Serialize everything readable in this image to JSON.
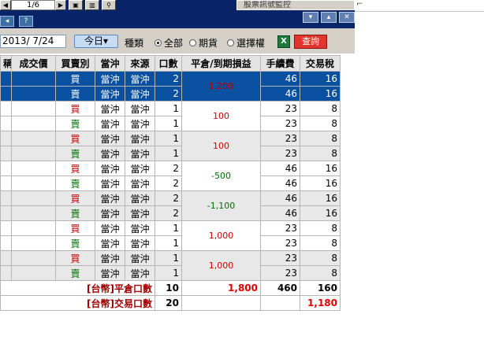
{
  "toolbar": {
    "page_info": "1/6",
    "tab_title": "股票訊號監控"
  },
  "filter": {
    "date": "2013/ 7/24",
    "today_label": "今日▾",
    "type_label": "種類",
    "radio_all": "全部",
    "radio_futures": "期貨",
    "radio_options": "選擇權",
    "query_label": "查詢",
    "excel_icon": "excel-icon"
  },
  "table": {
    "headers": [
      "稱",
      "成交價",
      "買賣別",
      "當沖",
      "來源",
      "口數",
      "平倉/到期損益",
      "手續費",
      "交易稅"
    ],
    "rows": [
      {
        "side": "買",
        "daytrade": "當沖",
        "source": "當沖",
        "qty": "2",
        "pnl": "1,200",
        "fee": "46",
        "tax": "16"
      },
      {
        "side": "賣",
        "daytrade": "當沖",
        "source": "當沖",
        "qty": "2",
        "pnl": "",
        "fee": "46",
        "tax": "16"
      },
      {
        "side": "買",
        "daytrade": "當沖",
        "source": "當沖",
        "qty": "1",
        "pnl": "100",
        "fee": "23",
        "tax": "8"
      },
      {
        "side": "賣",
        "daytrade": "當沖",
        "source": "當沖",
        "qty": "1",
        "pnl": "",
        "fee": "23",
        "tax": "8"
      },
      {
        "side": "買",
        "daytrade": "當沖",
        "source": "當沖",
        "qty": "1",
        "pnl": "100",
        "fee": "23",
        "tax": "8"
      },
      {
        "side": "賣",
        "daytrade": "當沖",
        "source": "當沖",
        "qty": "1",
        "pnl": "",
        "fee": "23",
        "tax": "8"
      },
      {
        "side": "買",
        "daytrade": "當沖",
        "source": "當沖",
        "qty": "2",
        "pnl": "-500",
        "fee": "46",
        "tax": "16"
      },
      {
        "side": "賣",
        "daytrade": "當沖",
        "source": "當沖",
        "qty": "2",
        "pnl": "",
        "fee": "46",
        "tax": "16"
      },
      {
        "side": "買",
        "daytrade": "當沖",
        "source": "當沖",
        "qty": "2",
        "pnl": "-1,100",
        "fee": "46",
        "tax": "16"
      },
      {
        "side": "賣",
        "daytrade": "當沖",
        "source": "當沖",
        "qty": "2",
        "pnl": "",
        "fee": "46",
        "tax": "16"
      },
      {
        "side": "買",
        "daytrade": "當沖",
        "source": "當沖",
        "qty": "1",
        "pnl": "1,000",
        "fee": "23",
        "tax": "8"
      },
      {
        "side": "賣",
        "daytrade": "當沖",
        "source": "當沖",
        "qty": "1",
        "pnl": "",
        "fee": "23",
        "tax": "8"
      },
      {
        "side": "買",
        "daytrade": "當沖",
        "source": "當沖",
        "qty": "1",
        "pnl": "1,000",
        "fee": "23",
        "tax": "8"
      },
      {
        "side": "賣",
        "daytrade": "當沖",
        "source": "當沖",
        "qty": "1",
        "pnl": "",
        "fee": "23",
        "tax": "8"
      }
    ],
    "total_close": {
      "label": "[台幣]平倉口數",
      "qty": "10",
      "pnl": "1,800",
      "fee": "460",
      "tax": "160"
    },
    "total_trade": {
      "label": "[台幣]交易口數",
      "qty": "20",
      "tax": "1,180"
    }
  }
}
